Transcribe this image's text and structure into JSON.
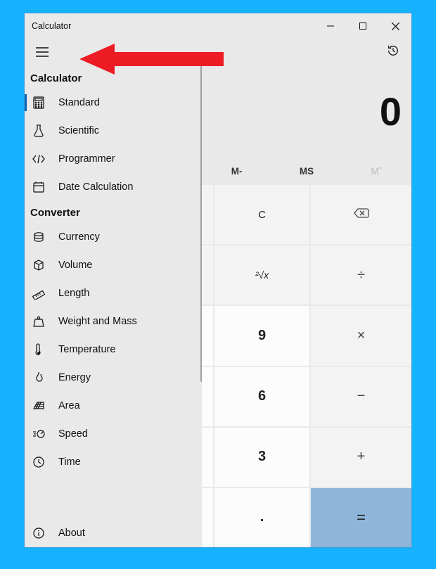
{
  "window": {
    "title": "Calculator"
  },
  "nav": {
    "calc_heading": "Calculator",
    "conv_heading": "Converter",
    "items": {
      "standard": "Standard",
      "scientific": "Scientific",
      "programmer": "Programmer",
      "datecalc": "Date Calculation",
      "currency": "Currency",
      "volume": "Volume",
      "length": "Length",
      "weight": "Weight and Mass",
      "temperature": "Temperature",
      "energy": "Energy",
      "area": "Area",
      "speed": "Speed",
      "time": "Time",
      "about": "About"
    }
  },
  "display": {
    "value": "0"
  },
  "memory": {
    "m_minus": "M-",
    "ms": "MS",
    "m_flyout": "Mˇ"
  },
  "keys": {
    "clear": "C",
    "root": "²√x",
    "nine": "9",
    "six": "6",
    "three": "3",
    "dot": ".",
    "divide": "÷",
    "multiply": "×",
    "minus": "−",
    "plus": "+",
    "equals": "="
  }
}
